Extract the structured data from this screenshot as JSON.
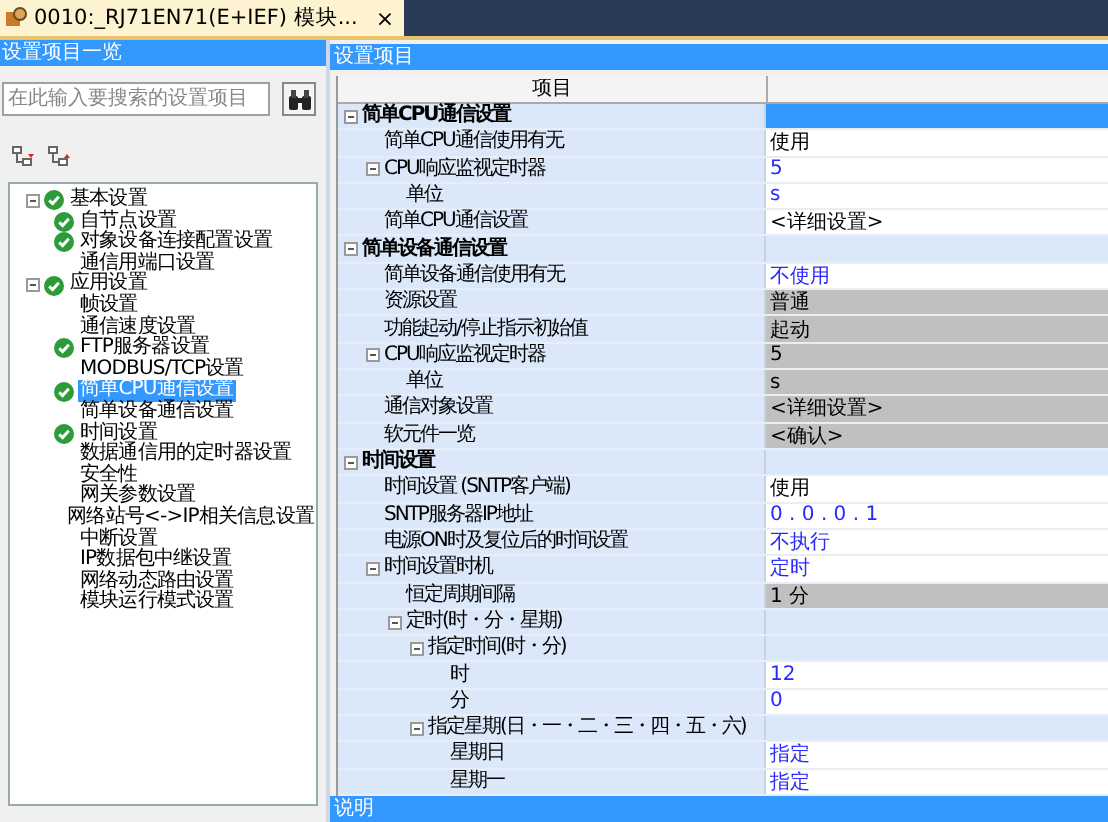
{
  "tab": {
    "title": "0010:_RJ71EN71(E+IEF) 模块...",
    "close": "×",
    "selected": true
  },
  "side_panel": {
    "title": "设置项目一览",
    "search": {
      "placeholder": "在此输入要搜索的设置项目"
    },
    "tree": [
      {
        "label": "基本设置",
        "configured": true,
        "selected": false,
        "expanded": true,
        "children": [
          {
            "label": "自节点设置",
            "configured": true,
            "selected": false
          },
          {
            "label": "对象设备连接配置设置",
            "configured": true,
            "selected": false
          },
          {
            "label": "通信用端口设置",
            "configured": false,
            "selected": false
          }
        ]
      },
      {
        "label": "应用设置",
        "configured": true,
        "selected": false,
        "expanded": true,
        "children": [
          {
            "label": "帧设置",
            "configured": false,
            "selected": false
          },
          {
            "label": "通信速度设置",
            "configured": false,
            "selected": false
          },
          {
            "label": "FTP服务器设置",
            "configured": true,
            "selected": false
          },
          {
            "label": "MODBUS/TCP设置",
            "configured": false,
            "selected": false
          },
          {
            "label": "简单CPU通信设置",
            "configured": true,
            "selected": true
          },
          {
            "label": "简单设备通信设置",
            "configured": false,
            "selected": false
          },
          {
            "label": "时间设置",
            "configured": true,
            "selected": false
          },
          {
            "label": "数据通信用的定时器设置",
            "configured": false,
            "selected": false
          },
          {
            "label": "安全性",
            "configured": false,
            "selected": false
          },
          {
            "label": "网关参数设置",
            "configured": false,
            "selected": false
          },
          {
            "label": "网络站号<->IP相关信息设置",
            "configured": false,
            "selected": false
          },
          {
            "label": "中断设置",
            "configured": false,
            "selected": false
          },
          {
            "label": "IP数据包中继设置",
            "configured": false,
            "selected": false
          },
          {
            "label": "网络动态路由设置",
            "configured": false,
            "selected": false
          },
          {
            "label": "模块运行模式设置",
            "configured": false,
            "selected": false
          }
        ]
      }
    ]
  },
  "settings": {
    "title": "设置项目",
    "columns": [
      "项目"
    ],
    "rows": [
      {
        "kind": "group",
        "label": "简单CPU通信设置",
        "selected": true,
        "expanded": true,
        "children": [
          {
            "kind": "item",
            "label": "简单CPU通信使用有无",
            "value": "使用",
            "disabled": false,
            "changed": false,
            "selected": false
          },
          {
            "kind": "item",
            "label": "CPU响应监视定时器",
            "value": "5",
            "disabled": false,
            "changed": true,
            "selected": false,
            "expanded": true,
            "children": [
              {
                "kind": "item",
                "label": "单位",
                "value": "s",
                "disabled": false,
                "changed": true,
                "selected": false
              }
            ]
          },
          {
            "kind": "item",
            "label": "简单CPU通信设置",
            "value": "<详细设置>",
            "disabled": false,
            "changed": false,
            "selected": false
          }
        ]
      },
      {
        "kind": "group",
        "label": "简单设备通信设置",
        "selected": false,
        "expanded": true,
        "children": [
          {
            "kind": "item",
            "label": "简单设备通信使用有无",
            "value": "不使用",
            "disabled": false,
            "changed": true,
            "selected": false
          },
          {
            "kind": "item",
            "label": "资源设置",
            "value": "普通",
            "disabled": true,
            "changed": false,
            "selected": false
          },
          {
            "kind": "item",
            "label": "功能起动/停止指示初始值",
            "value": "起动",
            "disabled": true,
            "changed": false,
            "selected": false
          },
          {
            "kind": "item",
            "label": "CPU响应监视定时器",
            "value": "5",
            "disabled": true,
            "changed": false,
            "selected": false,
            "expanded": true,
            "children": [
              {
                "kind": "item",
                "label": "单位",
                "value": "s",
                "disabled": true,
                "changed": false,
                "selected": false
              }
            ]
          },
          {
            "kind": "item",
            "label": "通信对象设置",
            "value": "<详细设置>",
            "disabled": true,
            "changed": false,
            "selected": false
          },
          {
            "kind": "item",
            "label": "软元件一览",
            "value": "<确认>",
            "disabled": true,
            "changed": false,
            "selected": false
          }
        ]
      },
      {
        "kind": "group",
        "label": "时间设置",
        "selected": false,
        "expanded": true,
        "children": [
          {
            "kind": "item",
            "label": "时间设置 (SNTP客户端)",
            "value": "使用",
            "disabled": false,
            "changed": false,
            "selected": false
          },
          {
            "kind": "item",
            "label": "SNTP服务器IP地址",
            "value": "0 . 0 . 0 . 1",
            "disabled": false,
            "changed": true,
            "selected": false
          },
          {
            "kind": "item",
            "label": "电源ON时及复位后的时间设置",
            "value": "不执行",
            "disabled": false,
            "changed": true,
            "selected": false
          },
          {
            "kind": "item",
            "label": "时间设置时机",
            "value": "定时",
            "disabled": false,
            "changed": true,
            "selected": false,
            "expanded": true,
            "children": [
              {
                "kind": "item",
                "label": "恒定周期间隔",
                "value": "1 分",
                "disabled": true,
                "changed": false,
                "selected": false
              },
              {
                "kind": "item",
                "label": "定时(时・分・星期)",
                "selected": false,
                "expanded": true,
                "children": [
                  {
                    "kind": "item",
                    "label": "指定时间(时・分)",
                    "selected": false,
                    "expanded": true,
                    "children": [
                      {
                        "kind": "item",
                        "label": "时",
                        "value": "12",
                        "disabled": false,
                        "changed": true,
                        "selected": false
                      },
                      {
                        "kind": "item",
                        "label": "分",
                        "value": "0",
                        "disabled": false,
                        "changed": true,
                        "selected": false
                      }
                    ]
                  },
                  {
                    "kind": "item",
                    "label": "指定星期(日・一・二・三・四・五・六)",
                    "selected": false,
                    "expanded": true,
                    "children": [
                      {
                        "kind": "item",
                        "label": "星期日",
                        "value": "指定",
                        "disabled": false,
                        "changed": true,
                        "selected": false
                      },
                      {
                        "kind": "item",
                        "label": "星期一",
                        "value": "指定",
                        "disabled": false,
                        "changed": true,
                        "selected": false
                      }
                    ]
                  }
                ]
              }
            ]
          }
        ]
      }
    ]
  },
  "description": {
    "title": "说明"
  }
}
